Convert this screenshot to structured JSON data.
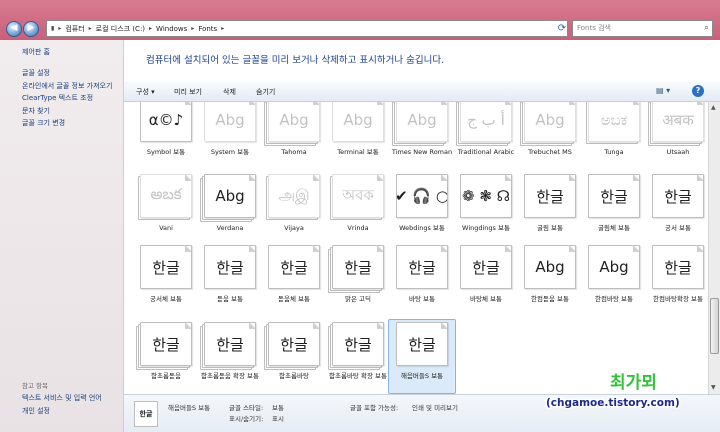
{
  "address": {
    "segments": [
      "컴퓨터",
      "로컬 디스크 (C:)",
      "Windows",
      "Fonts"
    ],
    "search_placeholder": "Fonts 검색"
  },
  "nav": {
    "back_icon": "back-arrow-icon",
    "forward_icon": "forward-arrow-icon"
  },
  "left_pane": {
    "home": "제어판 홈",
    "links": [
      "글꼴 설정",
      "온라인에서 글꼴 정보 가져오기",
      "ClearType 텍스트 조정",
      "문자 찾기",
      "글꼴 크기 변경"
    ],
    "see_also_title": "참고 항목",
    "see_also": [
      "텍스트 서비스 및 입력 언어",
      "개인 설정"
    ]
  },
  "banner": {
    "text": "컴퓨터에 설치되어 있는 글꼴을 미리 보거나 삭제하고 표시하거나 숨깁니다."
  },
  "toolbar": {
    "organize": "구성 ▾",
    "preview": "미리 보기",
    "delete": "삭제",
    "hide": "숨기기",
    "view_icon": "view-options-icon",
    "help_icon": "help-icon"
  },
  "fonts": [
    {
      "name": "Symbol 보통",
      "sample": "α©♪",
      "stack": 1,
      "ghost": false
    },
    {
      "name": "System 보통",
      "sample": "Abg",
      "stack": 1,
      "ghost": true
    },
    {
      "name": "Tahoma",
      "sample": "Abg",
      "stack": 3,
      "ghost": true
    },
    {
      "name": "Terminal 보통",
      "sample": "Abg",
      "stack": 1,
      "ghost": true
    },
    {
      "name": "Times New Roman",
      "sample": "Abg",
      "stack": 3,
      "ghost": true
    },
    {
      "name": "Traditional Arabic",
      "sample": "أ ب ج",
      "stack": 3,
      "ghost": true
    },
    {
      "name": "Trebuchet MS",
      "sample": "Abg",
      "stack": 3,
      "ghost": true
    },
    {
      "name": "Tunga",
      "sample": "ಅಬಕ",
      "stack": 2,
      "ghost": true
    },
    {
      "name": "Utsaah",
      "sample": "अबक",
      "stack": 3,
      "ghost": true
    },
    {
      "name": "Vani",
      "sample": "అబక",
      "stack": 2,
      "ghost": true
    },
    {
      "name": "Verdana",
      "sample": "Abg",
      "stack": 3,
      "ghost": false
    },
    {
      "name": "Vijaya",
      "sample": "அஇ",
      "stack": 2,
      "ghost": true
    },
    {
      "name": "Vrinda",
      "sample": "অবক",
      "stack": 2,
      "ghost": true
    },
    {
      "name": "Webdings 보통",
      "sample": "✔ 🎧 ○",
      "stack": 1,
      "ghost": false
    },
    {
      "name": "Wingdings 보통",
      "sample": "❁ ❃ ☊",
      "stack": 1,
      "ghost": false
    },
    {
      "name": "굴림 보통",
      "sample": "한글",
      "stack": 1,
      "ghost": false
    },
    {
      "name": "굴림체 보통",
      "sample": "한글",
      "stack": 1,
      "ghost": false
    },
    {
      "name": "궁서 보통",
      "sample": "한글",
      "stack": 1,
      "ghost": false
    },
    {
      "name": "궁서체 보통",
      "sample": "한글",
      "stack": 1,
      "ghost": false
    },
    {
      "name": "돋움 보통",
      "sample": "한글",
      "stack": 1,
      "ghost": false
    },
    {
      "name": "돋움체 보통",
      "sample": "한글",
      "stack": 1,
      "ghost": false
    },
    {
      "name": "맑은 고딕",
      "sample": "한글",
      "stack": 3,
      "ghost": false
    },
    {
      "name": "바탕 보통",
      "sample": "한글",
      "stack": 1,
      "ghost": false
    },
    {
      "name": "바탕체 보통",
      "sample": "한글",
      "stack": 1,
      "ghost": false
    },
    {
      "name": "한컴돋움 보통",
      "sample": "Abg",
      "stack": 1,
      "ghost": false
    },
    {
      "name": "한컴바탕 보통",
      "sample": "Abg",
      "stack": 1,
      "ghost": false
    },
    {
      "name": "한컴바탕확장 보통",
      "sample": "한글",
      "stack": 1,
      "ghost": false
    },
    {
      "name": "함초롬돋움",
      "sample": "한글",
      "stack": 3,
      "ghost": false
    },
    {
      "name": "함초롬돋움 확장 보통",
      "sample": "한글",
      "stack": 3,
      "ghost": false
    },
    {
      "name": "함초롬바탕",
      "sample": "한글",
      "stack": 3,
      "ghost": false
    },
    {
      "name": "함초롬바탕 확장 보통",
      "sample": "한글",
      "stack": 3,
      "ghost": false
    },
    {
      "name": "해음버들S 보통",
      "sample": "한글",
      "stack": 1,
      "ghost": false,
      "selected": true
    }
  ],
  "details": {
    "icon_text": "한글",
    "name": "해음버들S 보통",
    "style_label": "글꼴 스타일:",
    "style_value": "보통",
    "visibility_label": "표시/숨기기:",
    "visibility_value": "표시",
    "embed_label": "글꼴 포함 가능성:",
    "embed_value": "인쇄 및 미리보기"
  },
  "watermark": {
    "hangul": "최가뫼",
    "url": "(chgamoe.tistory.com)"
  }
}
